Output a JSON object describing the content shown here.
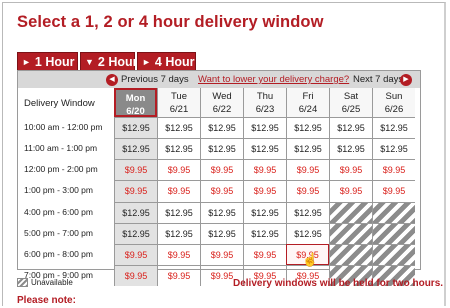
{
  "page_title": "Select a 1, 2 or 4 hour delivery window",
  "tabs": [
    {
      "label": "1 Hour",
      "glyph": "►",
      "active": true
    },
    {
      "label": "2 Hour",
      "glyph": "▼",
      "active": false
    },
    {
      "label": "4 Hour",
      "glyph": "►",
      "active": false
    }
  ],
  "nav": {
    "prev_label": "Previous 7 days",
    "charge_link": "Want to lower your delivery charge?",
    "next_label": "Next 7 days",
    "prev_icon": "left-arrow-icon",
    "next_icon": "right-arrow-icon"
  },
  "grid": {
    "header_label": "Delivery Window",
    "days": [
      {
        "day": "Mon",
        "date": "6/20",
        "selected": true
      },
      {
        "day": "Tue",
        "date": "6/21"
      },
      {
        "day": "Wed",
        "date": "6/22"
      },
      {
        "day": "Thu",
        "date": "6/23"
      },
      {
        "day": "Fri",
        "date": "6/24"
      },
      {
        "day": "Sat",
        "date": "6/25"
      },
      {
        "day": "Sun",
        "date": "6/26"
      }
    ],
    "rows": [
      {
        "time": "10:00 am - 12:00 pm",
        "cells": [
          "$12.95",
          "$12.95",
          "$12.95",
          "$12.95",
          "$12.95",
          "$12.95",
          "$12.95"
        ],
        "color": "black"
      },
      {
        "time": "11:00 am - 1:00 pm",
        "cells": [
          "$12.95",
          "$12.95",
          "$12.95",
          "$12.95",
          "$12.95",
          "$12.95",
          "$12.95"
        ],
        "color": "black"
      },
      {
        "time": "12:00 pm - 2:00 pm",
        "cells": [
          "$9.95",
          "$9.95",
          "$9.95",
          "$9.95",
          "$9.95",
          "$9.95",
          "$9.95"
        ],
        "color": "red"
      },
      {
        "time": "1:00 pm - 3:00 pm",
        "cells": [
          "$9.95",
          "$9.95",
          "$9.95",
          "$9.95",
          "$9.95",
          "$9.95",
          "$9.95"
        ],
        "color": "red"
      },
      {
        "time": "4:00 pm - 6:00 pm",
        "cells": [
          "$12.95",
          "$12.95",
          "$12.95",
          "$12.95",
          "$12.95",
          "",
          ""
        ],
        "color": "black"
      },
      {
        "time": "5:00 pm - 7:00 pm",
        "cells": [
          "$12.95",
          "$12.95",
          "$12.95",
          "$12.95",
          "$12.95",
          "",
          ""
        ],
        "color": "black"
      },
      {
        "time": "6:00 pm - 8:00 pm",
        "cells": [
          "$9.95",
          "$9.95",
          "$9.95",
          "$9.95",
          "$9.95",
          "",
          ""
        ],
        "color": "red"
      },
      {
        "time": "7:00 pm - 9:00 pm",
        "cells": [
          "$9.95",
          "$9.95",
          "$9.95",
          "$9.95",
          "$9.95",
          "",
          ""
        ],
        "color": "red"
      }
    ],
    "unavailable_cells": [
      [
        4,
        5
      ],
      [
        4,
        6
      ],
      [
        5,
        5
      ],
      [
        5,
        6
      ],
      [
        6,
        5
      ],
      [
        6,
        6
      ],
      [
        7,
        5
      ],
      [
        7,
        6
      ]
    ],
    "hover_cell": [
      6,
      4
    ]
  },
  "legend": {
    "label": "Unavailable"
  },
  "held_note": "Delivery windows will be held for two hours.",
  "please_note": "Please note:"
}
